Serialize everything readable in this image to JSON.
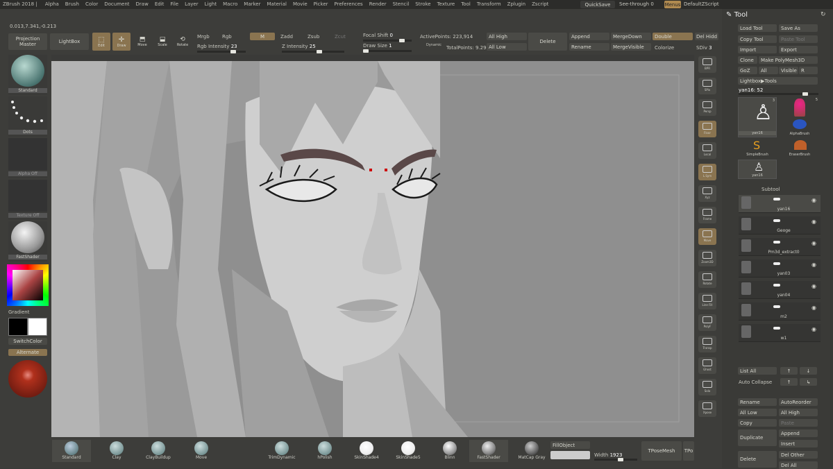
{
  "window": {
    "title": "ZBrush 2018 |"
  },
  "menu": {
    "items": [
      "Alpha",
      "Brush",
      "Color",
      "Document",
      "Draw",
      "Edit",
      "File",
      "Layer",
      "Light",
      "Macro",
      "Marker",
      "Material",
      "Movie",
      "Picker",
      "Preferences",
      "Render",
      "Stencil",
      "Stroke",
      "Texture",
      "Tool",
      "Transform",
      "Zplugin",
      "Zscript"
    ],
    "quicksave": "QuickSave",
    "seethrough": "See-through",
    "seethrough_val": "0",
    "menus": "Menus",
    "defaultzscript": "DefaultZScript"
  },
  "coords": "0.013,7.341,-0.213",
  "top": {
    "projection_master": "Projection Master",
    "lightbox": "LightBox",
    "edit": "Edit",
    "draw": "Draw",
    "move": "Move",
    "scale": "Scale",
    "rotate": "Rotate",
    "mrgb": "Mrgb",
    "rgb": "Rgb",
    "m": "M",
    "zadd": "Zadd",
    "zsub": "Zsub",
    "zcut": "Zcut",
    "rgb_intensity": "Rgb Intensity",
    "rgb_intensity_val": "23",
    "z_intensity": "Z Intensity",
    "z_intensity_val": "25",
    "focal_shift": "Focal Shift",
    "focal_shift_val": "0",
    "draw_size": "Draw Size",
    "draw_size_val": "1",
    "dynamic": "Dynamic",
    "active_points": "ActivePoints: 223,914",
    "total_points": "TotalPoints: 9.29",
    "all_high": "All High",
    "all_low": "All Low",
    "delete": "Delete",
    "append": "Append",
    "rename": "Rename",
    "merge_down": "MergeDown",
    "merge_visible": "MergeVisible",
    "double": "Double",
    "colorize": "Colorize",
    "del_hidden": "Del Hidd",
    "sdiv": "SDiv",
    "sdiv_val": "3"
  },
  "left": {
    "brush": "Standard",
    "stroke": "Dots",
    "alpha": "Alpha Off",
    "texture": "Texture Off",
    "material": "FastShader",
    "gradient": "Gradient",
    "switch_color": "SwitchColor",
    "alternate": "Alternate"
  },
  "bottom": {
    "brushes": [
      "Standard",
      "Clay",
      "ClayBuildup",
      "Move",
      "TrimDynamic",
      "hPolish",
      "SkinShade4",
      "SkinShade5",
      "Blinn",
      "FastShader",
      "MatCap Gray"
    ],
    "fill_object": "FillObject",
    "width_label": "Width",
    "width_val": "1923",
    "tposemesh": "TPoseMesh",
    "tpo": "TPo"
  },
  "right": {
    "labels": [
      "BPR",
      "SPix",
      "Persp",
      "Floor",
      "Local",
      "L.Sym",
      "Xyz",
      "Frame",
      "Move",
      "Zoom3D",
      "Rotate",
      "Line Fill",
      "PolyF",
      "Transp",
      "Ghost",
      "Solo",
      "Xpose"
    ]
  },
  "tool": {
    "title": "Tool",
    "load_tool": "Load Tool",
    "save_as": "Save As",
    "copy_tool": "Copy Tool",
    "paste_tool": "Paste Tool",
    "import": "Import",
    "export": "Export",
    "clone": "Clone",
    "make_polymesh": "Make PolyMesh3D",
    "goz": "GoZ",
    "all": "All",
    "visible": "Visible",
    "r": "R",
    "lightbox_tools": "Lightbox▶Tools",
    "current": "yan16:",
    "current_val": "52",
    "thumbs": [
      "yan16",
      "AlphaBrush",
      "SimpleBrush",
      "EraserBrush",
      "yan16"
    ],
    "thumb_num1": "3",
    "thumb_num2": "5",
    "subtool": "Subtool",
    "subtools": [
      "yan16",
      "Geoge",
      "Pm3d_extract0",
      "yan03",
      "yan04",
      "m2",
      "w1"
    ],
    "list_all": "List All",
    "auto_collapse": "Auto Collapse",
    "rename": "Rename",
    "auto_reorder": "AutoReorder",
    "all_low": "All Low",
    "all_high": "All High",
    "copy": "Copy",
    "paste": "Paste",
    "duplicate": "Duplicate",
    "append": "Append",
    "insert": "Insert",
    "delete": "Delete",
    "del_other": "Del Other",
    "del_all": "Del All"
  }
}
